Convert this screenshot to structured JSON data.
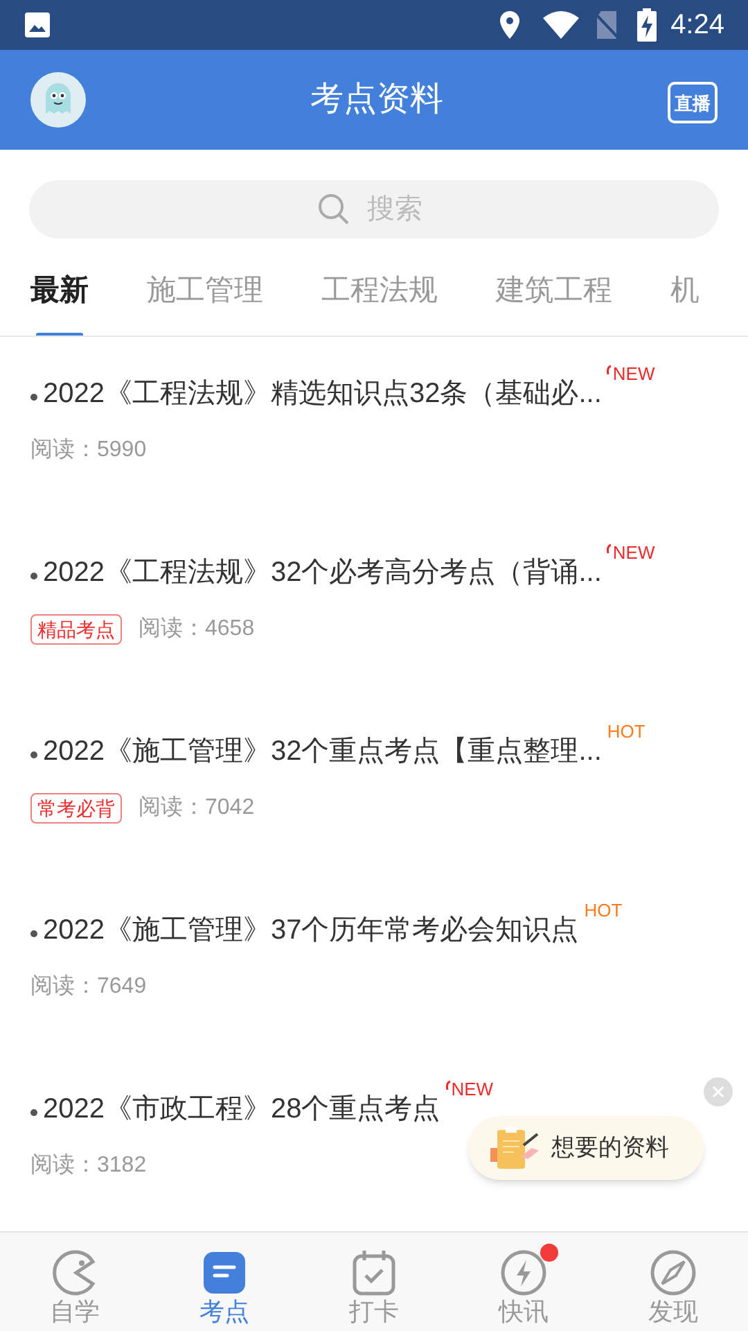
{
  "status_bar": {
    "time": "4:24"
  },
  "header": {
    "title": "考点资料",
    "live_label": "直播"
  },
  "search": {
    "placeholder": "搜索"
  },
  "tabs": [
    {
      "label": "最新",
      "selected": true
    },
    {
      "label": "施工管理",
      "selected": false
    },
    {
      "label": "工程法规",
      "selected": false
    },
    {
      "label": "建筑工程",
      "selected": false
    },
    {
      "label": "机",
      "selected": false
    }
  ],
  "articles": [
    {
      "title": "2022《工程法规》精选知识点32条（基础必...",
      "badge": {
        "kind": "new",
        "text": "NEW"
      },
      "reads": "阅读：5990"
    },
    {
      "title": "2022《工程法规》32个必考高分考点（背诵...",
      "badge": {
        "kind": "new",
        "text": "NEW"
      },
      "tag": "精品考点",
      "reads": "阅读：4658"
    },
    {
      "title": "2022《施工管理》32个重点考点【重点整理...",
      "badge": {
        "kind": "hot",
        "text": "HOT"
      },
      "tag": "常考必背",
      "reads": "阅读：7042"
    },
    {
      "title": "2022《施工管理》37个历年常考必会知识点",
      "badge": {
        "kind": "hot",
        "text": "HOT"
      },
      "reads": "阅读：7649"
    },
    {
      "title": "2022《市政工程》28个重点考点",
      "badge": {
        "kind": "new",
        "text": "NEW"
      },
      "reads": "阅读：3182"
    }
  ],
  "floating_button": {
    "label": "想要的资料"
  },
  "bottom_nav": [
    {
      "label": "自学",
      "kind": "pacman",
      "selected": false,
      "dot": false
    },
    {
      "label": "考点",
      "kind": "doc",
      "selected": true,
      "dot": false
    },
    {
      "label": "打卡",
      "kind": "calendar",
      "selected": false,
      "dot": false
    },
    {
      "label": "快讯",
      "kind": "bolt",
      "selected": false,
      "dot": true
    },
    {
      "label": "发现",
      "kind": "compass",
      "selected": false,
      "dot": false
    }
  ]
}
